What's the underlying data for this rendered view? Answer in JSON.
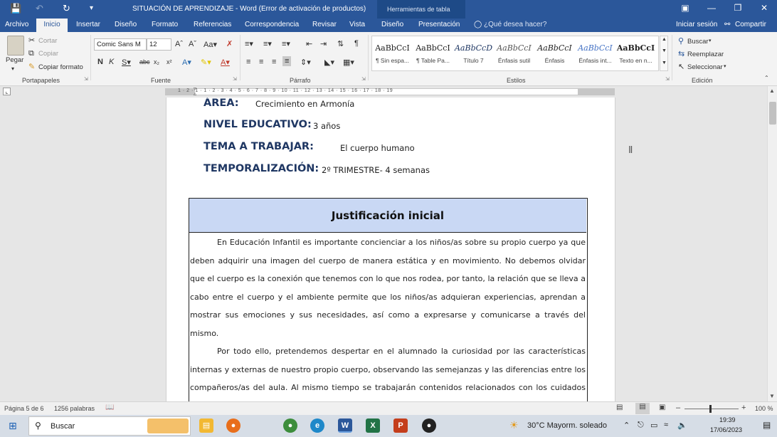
{
  "titlebar": {
    "title": "SITUACIÓN DE APRENDIZAJE - Word (Error de activación de productos)",
    "context_label": "Herramientas de tabla"
  },
  "tabs": [
    {
      "label": "Archivo"
    },
    {
      "label": "Inicio"
    },
    {
      "label": "Insertar"
    },
    {
      "label": "Diseño"
    },
    {
      "label": "Formato"
    },
    {
      "label": "Referencias"
    },
    {
      "label": "Correspondencia"
    },
    {
      "label": "Revisar"
    },
    {
      "label": "Vista"
    },
    {
      "label": "Diseño"
    },
    {
      "label": "Presentación"
    }
  ],
  "tell_me": "¿Qué desea hacer?",
  "account": {
    "signin": "Iniciar sesión",
    "share": "Compartir"
  },
  "ribbon": {
    "clipboard": {
      "paste": "Pegar",
      "cut": "Cortar",
      "copy": "Copiar",
      "format_painter": "Copiar formato",
      "label": "Portapapeles"
    },
    "font": {
      "name": "Comic Sans M",
      "size": "12",
      "label": "Fuente"
    },
    "paragraph": {
      "label": "Párrafo"
    },
    "styles": {
      "label": "Estilos",
      "items": [
        {
          "sample": "AaBbCcI",
          "name": "¶ Sin espa..."
        },
        {
          "sample": "AaBbCcI",
          "name": "¶ Table Pa..."
        },
        {
          "sample": "AaBbCcD",
          "name": "Título 7"
        },
        {
          "sample": "AaBbCcI",
          "name": "Énfasis sutil"
        },
        {
          "sample": "AaBbCcI",
          "name": "Énfasis"
        },
        {
          "sample": "AaBbCcI",
          "name": "Énfasis int..."
        },
        {
          "sample": "AaBbCcI",
          "name": "Texto en n..."
        }
      ]
    },
    "editing": {
      "find": "Buscar",
      "replace": "Reemplazar",
      "select": "Seleccionar",
      "label": "Edición"
    }
  },
  "ruler": {
    "labels": "1 · 2 · 1 · 1 · 2 · 3 · 4 · 5 · 6 · 7 · 8 · 9 · 10 · 11 · 12 · 13 · 14 · 15 · 16 · 17 · 18 · 19"
  },
  "document": {
    "fields": [
      {
        "label": "ÁREA:",
        "value": "Crecimiento en Armonía"
      },
      {
        "label": "NIVEL EDUCATIVO:",
        "value": "3 años"
      },
      {
        "label": "TEMA A TRABAJAR:",
        "value": "El cuerpo humano"
      },
      {
        "label": "TEMPORALIZACIÓN:",
        "value": "2º TRIMESTRE- 4 semanas"
      }
    ],
    "table_heading": "Justificación inicial",
    "paragraphs": [
      "En Educación Infantil es importante concienciar a los niños/as sobre su propio cuerpo ya que deben adquirir una imagen del cuerpo de manera estática y en movimiento. No debemos olvidar que el cuerpo es la conexión que tenemos con lo que nos rodea, por tanto, la relación que se lleva a cabo entre el cuerpo y el ambiente permite que los niños/as adquieran experiencias, aprendan a mostrar sus emociones y sus necesidades, así como a expresarse y comunicarse a través del mismo.",
      "Por todo ello, pretendemos despertar en el alumnado la curiosidad por las características internas y externas de nuestro propio cuerpo, observando las semejanzas y las diferencias entre los compañeros/as del aula. Al mismo tiempo se trabajarán contenidos relacionados con los cuidados que el cuerpo necesita; esto les ayudará a sentar las bases para la adquisición de hábitos y actitudes"
    ]
  },
  "statusbar": {
    "page": "Página 5 de 6",
    "words": "1256 palabras",
    "zoom": "100 %"
  },
  "taskbar": {
    "search": "Buscar",
    "weather": "30°C  Mayorm. soleado",
    "time": "19:39",
    "date": "17/06/2023"
  }
}
